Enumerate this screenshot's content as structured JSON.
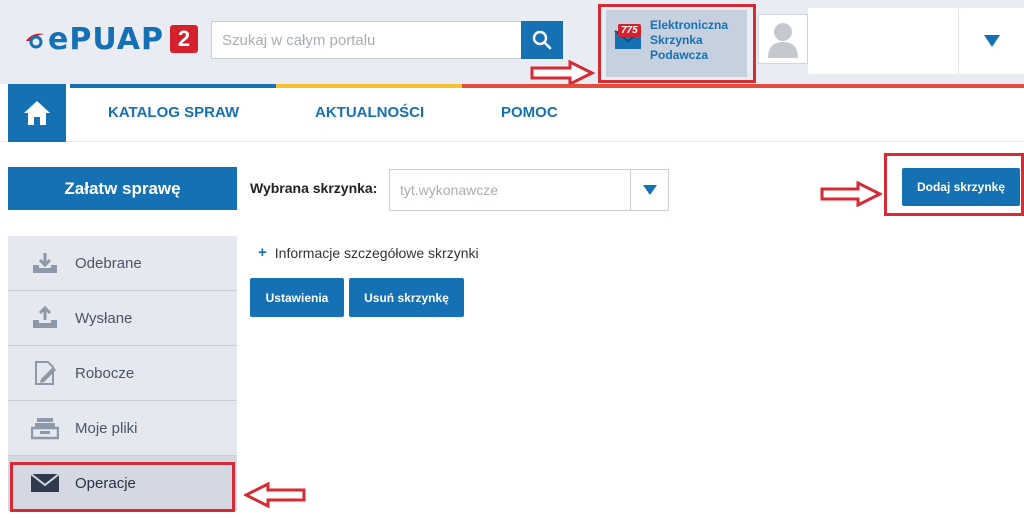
{
  "header": {
    "logo_text": "ePUAP",
    "logo_badge": "2",
    "search_placeholder": "Szukaj w całym portalu",
    "mailbox": {
      "count": "775",
      "label": "Elektroniczna Skrzynka Podawcza"
    }
  },
  "nav": {
    "items": [
      {
        "label": "KATALOG SPRAW"
      },
      {
        "label": "AKTUALNOŚCI"
      },
      {
        "label": "POMOC"
      }
    ]
  },
  "sidebar": {
    "primary_button": "Załatw sprawę",
    "items": [
      {
        "label": "Odebrane",
        "icon": "inbox-download-icon"
      },
      {
        "label": "Wysłane",
        "icon": "outbox-upload-icon"
      },
      {
        "label": "Robocze",
        "icon": "draft-edit-icon"
      },
      {
        "label": "Moje pliki",
        "icon": "files-tray-icon"
      },
      {
        "label": "Operacje",
        "icon": "envelope-icon"
      }
    ]
  },
  "main": {
    "selected_label": "Wybrana skrzynka:",
    "selected_value": "tyt.wykonawcze",
    "add_button": "Dodaj skrzynkę",
    "details_link": "Informacje szczegółowe skrzynki",
    "settings_button": "Ustawienia",
    "delete_button": "Usuń skrzynkę"
  },
  "colors": {
    "brand_blue": "#1670b4",
    "highlight_red": "#d62a34"
  }
}
